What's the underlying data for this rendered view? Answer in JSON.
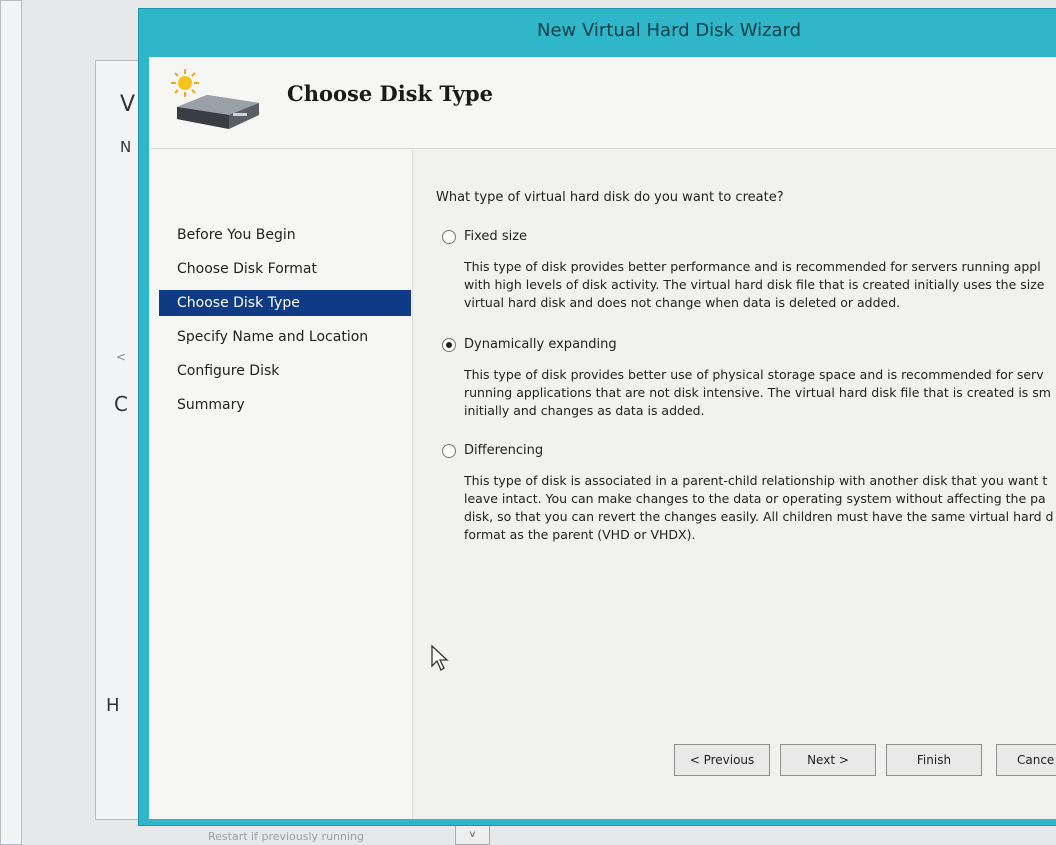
{
  "window": {
    "title": "New Virtual Hard Disk Wizard"
  },
  "header": {
    "heading": "Choose Disk Type",
    "icon": "virtual-hard-disk-wizard-icon"
  },
  "nav": {
    "items": [
      {
        "label": "Before You Begin",
        "selected": false
      },
      {
        "label": "Choose Disk Format",
        "selected": false
      },
      {
        "label": "Choose Disk Type",
        "selected": true
      },
      {
        "label": "Specify Name and Location",
        "selected": false
      },
      {
        "label": "Configure Disk",
        "selected": false
      },
      {
        "label": "Summary",
        "selected": false
      }
    ]
  },
  "content": {
    "question": "What type of virtual hard disk do you want to create?",
    "options": [
      {
        "label": "Fixed size",
        "checked": false,
        "description": [
          "This type of disk provides better performance and is recommended for servers running appl",
          "with high levels of disk activity. The virtual hard disk file that is created initially uses the size",
          "virtual hard disk and does not change when data is deleted or added."
        ]
      },
      {
        "label": "Dynamically expanding",
        "checked": true,
        "description": [
          "This type of disk provides better use of physical storage space and is recommended for serv",
          "running applications that are not disk intensive. The virtual hard disk file that is created is sm",
          "initially and changes as data is added."
        ]
      },
      {
        "label": "Differencing",
        "checked": false,
        "description": [
          "This type of disk is associated in a parent-child relationship with another disk that you want t",
          "leave intact. You can make changes to the data or operating system without affecting the pa",
          "disk, so that you can revert the changes easily. All children must have the same virtual hard d",
          "format as the parent (VHD or VHDX)."
        ]
      }
    ]
  },
  "buttons": {
    "previous": "< Previous",
    "next": "Next >",
    "finish": "Finish",
    "cancel": "Cance"
  },
  "background": {
    "letters": {
      "v": "V",
      "n": "N",
      "c": "C",
      "h": "H",
      "lt": "<"
    },
    "bottom_text": "Restart if previously running",
    "bottom_combo": "v"
  },
  "colors": {
    "titlebar": "#2fb7c9",
    "nav_selected": "#0f3b86"
  }
}
